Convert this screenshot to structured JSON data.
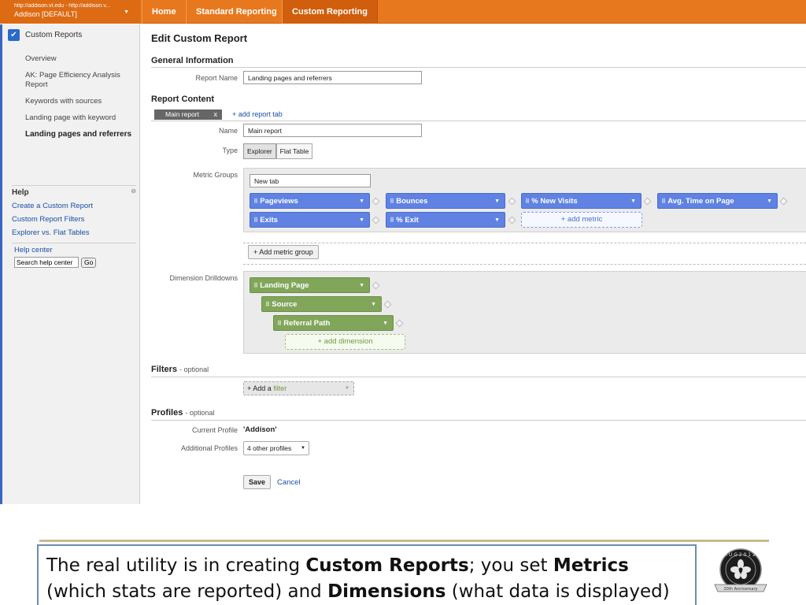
{
  "account": {
    "url": "http://addison.vt.edu - http://addison.v...",
    "profile": "Addison [DEFAULT]"
  },
  "nav": {
    "home": "Home",
    "standard": "Standard Reporting",
    "custom": "Custom Reporting"
  },
  "sidebar": {
    "title": "Custom Reports",
    "items": [
      "Overview",
      "AK: Page Efficiency Analysis Report",
      "Keywords with sources",
      "Landing page with keyword",
      "Landing pages and referrers"
    ],
    "help": {
      "title": "Help",
      "links": [
        "Create a Custom Report",
        "Custom Report Filters",
        "Explorer vs. Flat Tables"
      ],
      "center": "Help center",
      "search_placeholder": "Search help center",
      "go": "Go"
    }
  },
  "main": {
    "title": "Edit Custom Report",
    "general_info": "General Information",
    "report_name_label": "Report Name",
    "report_name": "Landing pages and referrers",
    "report_content": "Report Content",
    "tab": "Main report",
    "tab_close": "x",
    "add_tab": "+ add report tab",
    "name_label": "Name",
    "name_value": "Main report",
    "type_label": "Type",
    "type_options": [
      "Explorer",
      "Flat Table"
    ],
    "metric_groups_label": "Metric Groups",
    "metric_group_name": "New tab",
    "metrics": [
      "Pageviews",
      "Bounces",
      "% New Visits",
      "Avg. Time on Page",
      "Exits",
      "% Exit"
    ],
    "add_metric": "+ add metric",
    "add_metric_group": "+ Add metric group",
    "dimension_label": "Dimension Drilldowns",
    "dimensions": [
      "Landing Page",
      "Source",
      "Referral Path"
    ],
    "add_dimension": "+ add dimension",
    "filters": "Filters",
    "filters_optional": "- optional",
    "add_filter_prefix": "+ Add a ",
    "add_filter_word": "filter",
    "profiles": "Profiles",
    "profiles_optional": "- optional",
    "current_profile_label": "Current Profile",
    "current_profile": "'Addison'",
    "additional_profiles_label": "Additional Profiles",
    "additional_profiles": "4 other profiles",
    "save": "Save",
    "cancel": "Cancel"
  },
  "caption": {
    "t1": "The real utility is in creating ",
    "b1": "Custom Reports",
    "t2": "; you set ",
    "b2": "Metrics",
    "t3": " (which stats are reported) and ",
    "b3": "Dimensions",
    "t4": " (what data is displayed)"
  },
  "logo": {
    "text": "I U G 2 0 1 2",
    "ribbon": "20th Anniversary"
  },
  "colors": {
    "nav_orange": "#e8781e",
    "metric_blue": "#5f82e3",
    "dimension_green": "#81a65a",
    "link_blue": "#1a4fa8"
  }
}
